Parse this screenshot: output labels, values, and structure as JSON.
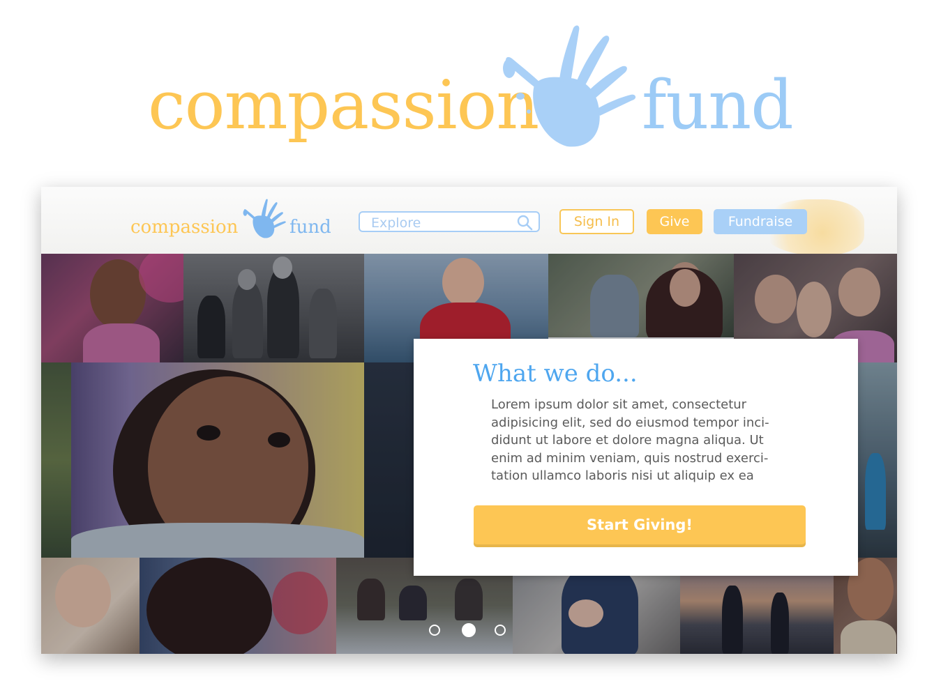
{
  "brand": {
    "word1": "compassion",
    "word2": "fund",
    "color_yellow": "#fdc654",
    "color_blue": "#9ccbf6",
    "logo_icon": "handprint-icon"
  },
  "nav": {
    "logo_word1": "compassion",
    "logo_word2": "fund",
    "search": {
      "placeholder": "Explore",
      "icon": "search-icon"
    },
    "signin_label": "Sign In",
    "give_label": "Give",
    "fundraise_label": "Fundraise"
  },
  "hero": {
    "card": {
      "title": "What we do...",
      "body_lines": [
        "Lorem ipsum dolor sit amet, consectetur",
        "adipisicing elit, sed do eiusmod tempor inci-",
        "didunt ut labore et dolore magna aliqua. Ut",
        "enim ad minim veniam, quis nostrud exerci-",
        "tation ullamco laboris nisi ut aliquip ex ea"
      ],
      "cta_label": "Start Giving!"
    },
    "carousel": {
      "slide_count": 3,
      "active_slide": 2
    }
  }
}
